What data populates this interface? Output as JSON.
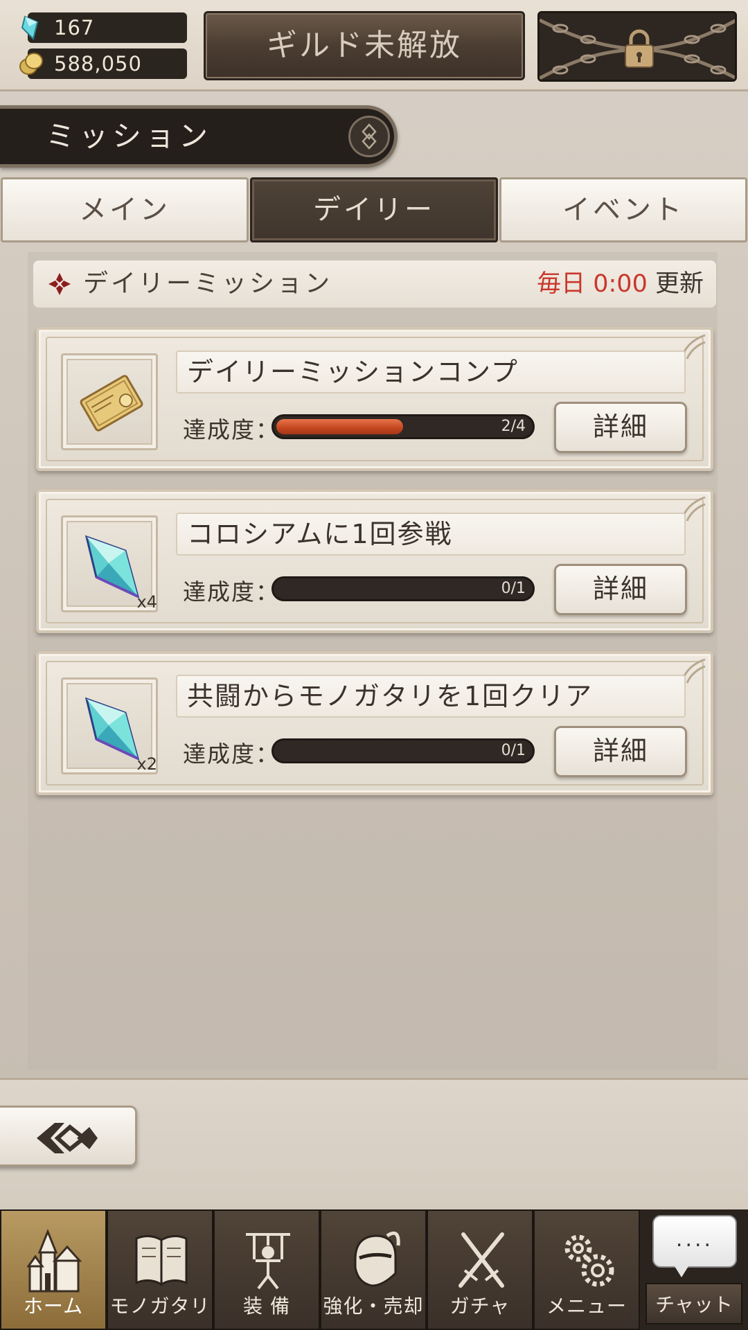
{
  "currency": {
    "gems": "167",
    "gold": "588,050"
  },
  "guild_button": "ギルド未解放",
  "section_title": "ミッション",
  "tabs": [
    {
      "label": "メイン",
      "active": false
    },
    {
      "label": "デイリー",
      "active": true
    },
    {
      "label": "イベント",
      "active": false
    }
  ],
  "sub_header": {
    "title": "デイリーミッション",
    "reset_prefix": "毎日",
    "reset_time": "0:00",
    "reset_suffix": "更新"
  },
  "missions": [
    {
      "title": "デイリーミッションコンプ",
      "progress_label": "達成度：",
      "progress_text": "2/4",
      "progress": 0.5,
      "reward_icon": "ticket-icon",
      "reward_qty": "",
      "detail_label": "詳細"
    },
    {
      "title": "コロシアムに1回参戦",
      "progress_label": "達成度：",
      "progress_text": "0/1",
      "progress": 0,
      "reward_icon": "crystal-icon",
      "reward_qty": "x4",
      "detail_label": "詳細"
    },
    {
      "title": "共闘からモノガタリを1回クリア",
      "progress_label": "達成度：",
      "progress_text": "0/1",
      "progress": 0,
      "reward_icon": "crystal-icon",
      "reward_qty": "x2",
      "detail_label": "詳細"
    }
  ],
  "nav": [
    {
      "label": "ホーム",
      "icon": "castle-icon",
      "active": true
    },
    {
      "label": "モノガタリ",
      "icon": "book-icon",
      "active": false
    },
    {
      "label": "装 備",
      "icon": "puppet-icon",
      "active": false
    },
    {
      "label": "強化・売却",
      "icon": "helmet-icon",
      "active": false
    },
    {
      "label": "ガチャ",
      "icon": "swords-icon",
      "active": false
    },
    {
      "label": "メニュー",
      "icon": "gears-icon",
      "active": false
    }
  ],
  "chat": {
    "dots": "....",
    "label": "チャット"
  },
  "colors": {
    "accent_red": "#c9372b",
    "progress_fill": "#c4461f",
    "dark_panel": "#241f1b"
  }
}
